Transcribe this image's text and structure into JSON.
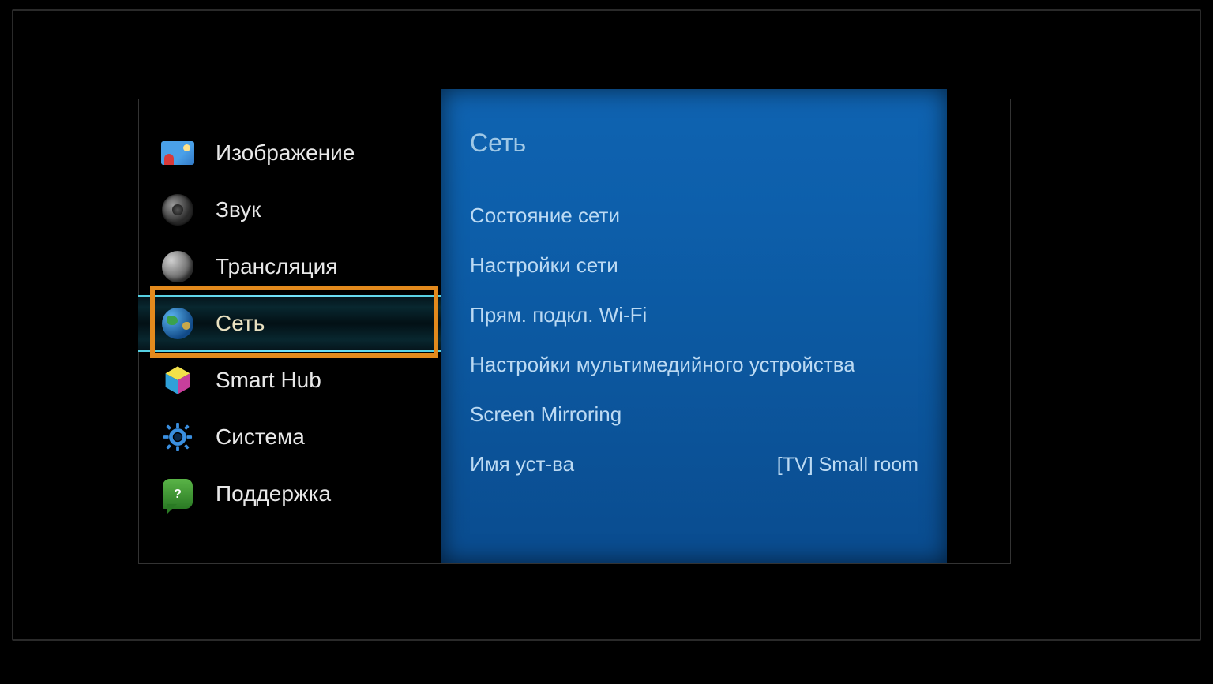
{
  "sidebar": {
    "selectedIndex": 3,
    "items": [
      {
        "label": "Изображение",
        "icon": "picture-icon"
      },
      {
        "label": "Звук",
        "icon": "sound-icon"
      },
      {
        "label": "Трансляция",
        "icon": "broadcast-icon"
      },
      {
        "label": "Сеть",
        "icon": "globe-icon"
      },
      {
        "label": "Smart Hub",
        "icon": "smarthub-icon"
      },
      {
        "label": "Система",
        "icon": "gear-icon"
      },
      {
        "label": "Поддержка",
        "icon": "support-icon"
      }
    ]
  },
  "panel": {
    "title": "Сеть",
    "items": [
      {
        "label": "Состояние сети"
      },
      {
        "label": "Настройки сети"
      },
      {
        "label": "Прям. подкл. Wi-Fi"
      },
      {
        "label": "Настройки мультимедийного устройства"
      },
      {
        "label": "Screen Mirroring"
      },
      {
        "label": "Имя уст-ва",
        "value": "[TV] Small room"
      }
    ]
  }
}
